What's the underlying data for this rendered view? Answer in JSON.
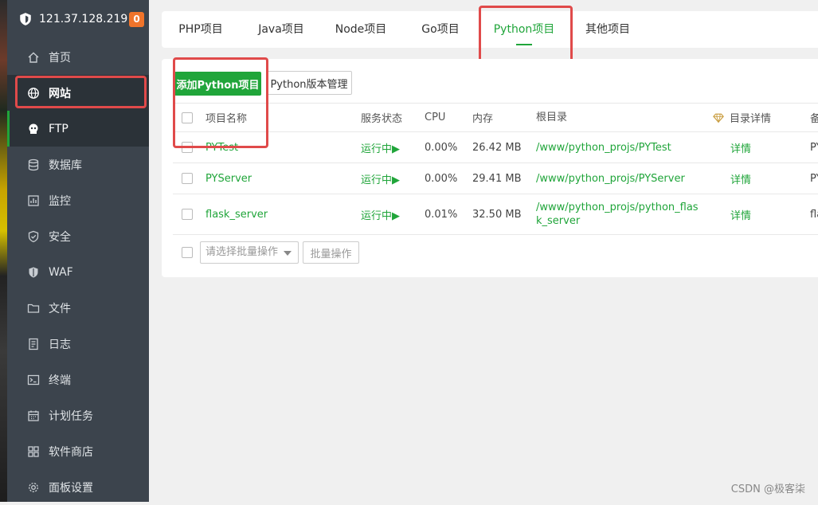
{
  "sidebar": {
    "ip": "121.37.128.219",
    "badge": "0",
    "items": [
      {
        "label": "首页",
        "icon": "home-icon"
      },
      {
        "label": "网站",
        "icon": "globe-icon"
      },
      {
        "label": "FTP",
        "icon": "ftp-icon"
      },
      {
        "label": "数据库",
        "icon": "database-icon"
      },
      {
        "label": "监控",
        "icon": "monitor-icon"
      },
      {
        "label": "安全",
        "icon": "shield-check-icon"
      },
      {
        "label": "WAF",
        "icon": "waf-shield-icon"
      },
      {
        "label": "文件",
        "icon": "folder-icon"
      },
      {
        "label": "日志",
        "icon": "log-icon"
      },
      {
        "label": "终端",
        "icon": "terminal-icon"
      },
      {
        "label": "计划任务",
        "icon": "calendar-icon"
      },
      {
        "label": "软件商店",
        "icon": "apps-grid-icon"
      },
      {
        "label": "面板设置",
        "icon": "gear-icon"
      }
    ]
  },
  "tabs": [
    "PHP项目",
    "Java项目",
    "Node项目",
    "Go项目",
    "Python项目",
    "其他项目"
  ],
  "active_tab": "Python项目",
  "toolbar": {
    "add_label": "添加Python项目",
    "version_label": "Python版本管理"
  },
  "table": {
    "headers": {
      "name": "项目名称",
      "status": "服务状态",
      "cpu": "CPU",
      "memory": "内存",
      "root": "根目录",
      "detail": "目录详情",
      "remark": "备注"
    },
    "rows": [
      {
        "name": "PYTest",
        "status": "运行中▶",
        "cpu": "0.00%",
        "memory": "26.42 MB",
        "root": "/www/python_projs/PYTest",
        "detail": "详情",
        "remark": "PY"
      },
      {
        "name": "PYServer",
        "status": "运行中▶",
        "cpu": "0.00%",
        "memory": "29.41 MB",
        "root": "/www/python_projs/PYServer",
        "detail": "详情",
        "remark": "PY"
      },
      {
        "name": "flask_server",
        "status": "运行中▶",
        "cpu": "0.01%",
        "memory": "32.50 MB",
        "root": "/www/python_projs/python_flask_server",
        "detail": "详情",
        "remark": "fla"
      }
    ]
  },
  "batch": {
    "placeholder": "请选择批量操作",
    "button": "批量操作"
  },
  "watermark": "CSDN @极客柒",
  "colors": {
    "accent": "#20a53a",
    "sidebar_bg": "#3c444d",
    "highlight": "#e04a4a",
    "badge": "#f0742b"
  }
}
